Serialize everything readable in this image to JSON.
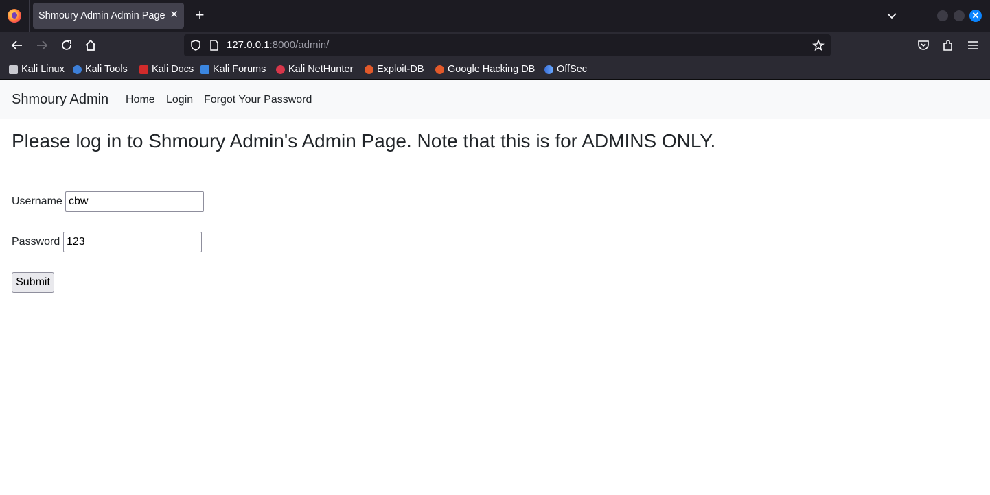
{
  "browser": {
    "tab_title": "Shmoury Admin Admin Page",
    "url_host": "127.0.0.1",
    "url_path": ":8000/admin/",
    "bookmarks": [
      {
        "label": "Kali Linux",
        "icon": "kali-dragon-icon"
      },
      {
        "label": "Kali Tools",
        "icon": "kali-tools-icon"
      },
      {
        "label": "Kali Docs",
        "icon": "kali-docs-icon"
      },
      {
        "label": "Kali Forums",
        "icon": "kali-forums-icon"
      },
      {
        "label": "Kali NetHunter",
        "icon": "nethunter-icon"
      },
      {
        "label": "Exploit-DB",
        "icon": "exploit-db-icon"
      },
      {
        "label": "Google Hacking DB",
        "icon": "ghdb-icon"
      },
      {
        "label": "OffSec",
        "icon": "offsec-icon"
      }
    ],
    "accent_color": "#0a84ff"
  },
  "site": {
    "brand": "Shmoury Admin",
    "nav": [
      "Home",
      "Login",
      "Forgot Your Password"
    ],
    "heading": "Please log in to Shmoury Admin's Admin Page. Note that this is for ADMINS ONLY.",
    "form": {
      "username_label": "Username",
      "username_value": "cbw",
      "password_label": "Password",
      "password_value": "123",
      "submit_label": "Submit"
    }
  }
}
